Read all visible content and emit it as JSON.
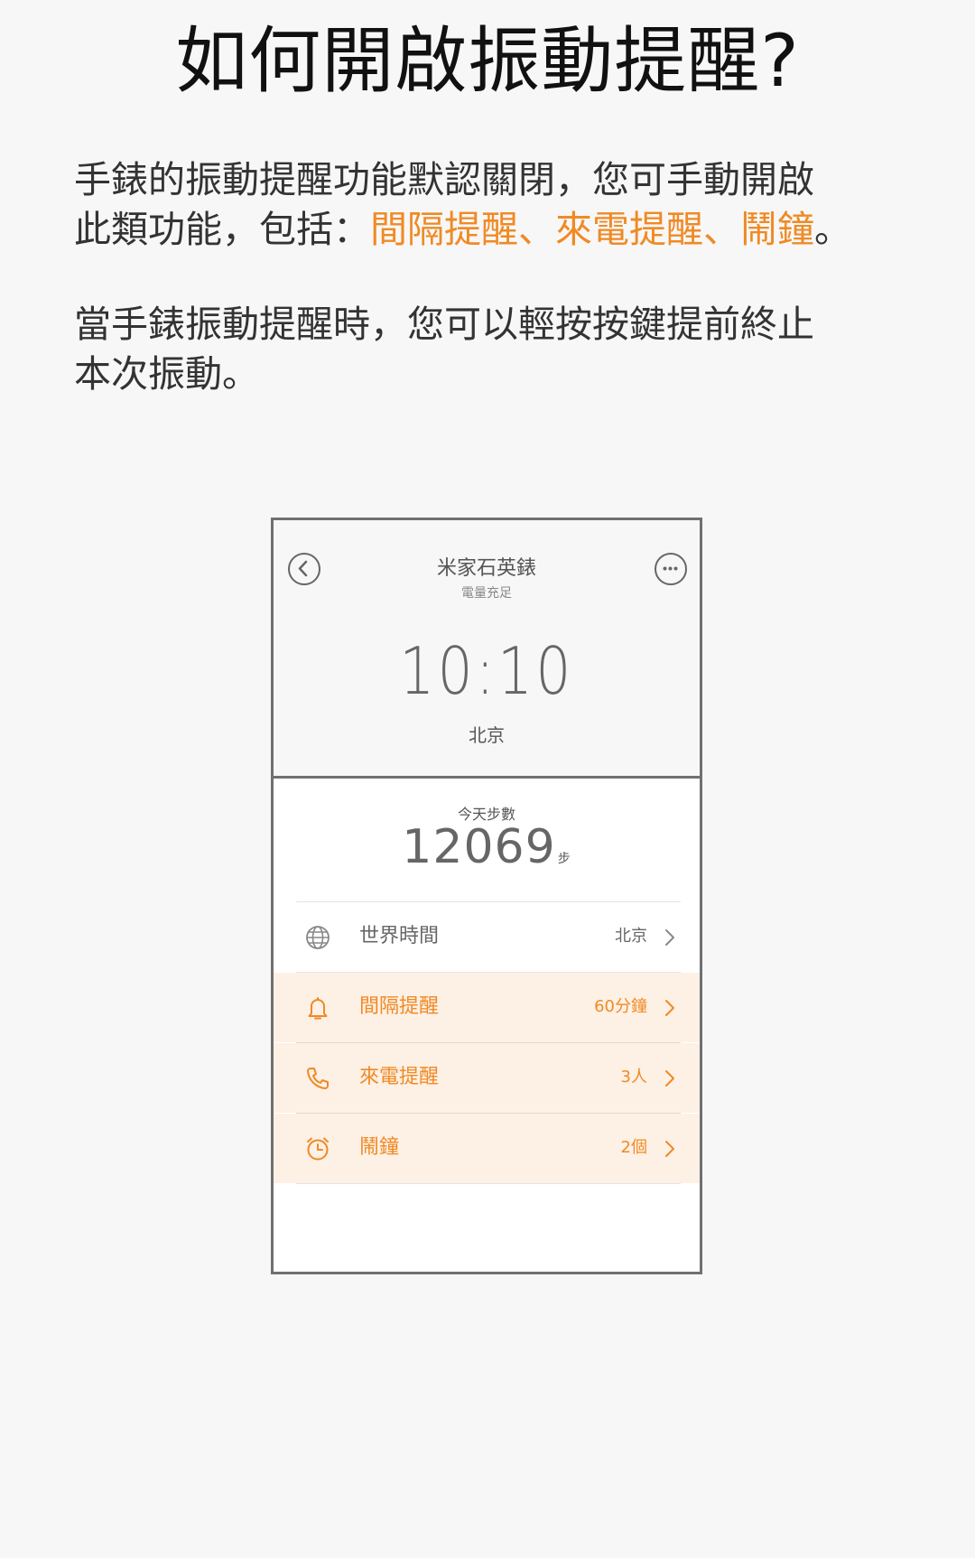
{
  "title": "如何開啟振動提醒?",
  "intro": {
    "line1": "手錶的振動提醒功能默認關閉，您可手動開啟",
    "line2_prefix": "此類功能，包括：",
    "line2_highlight": "間隔提醒、來電提醒、鬧鐘",
    "line2_suffix": "。"
  },
  "note": {
    "line1": "當手錶振動提醒時，您可以輕按按鍵提前終止",
    "line2": "本次振動。"
  },
  "phone": {
    "device_name": "米家石英錶",
    "battery_status": "電量充足",
    "time": "10:10",
    "city": "北京",
    "steps_label": "今天步數",
    "steps": "12069",
    "steps_unit": "步",
    "rows": [
      {
        "label": "世界時間",
        "value": "北京",
        "icon": "globe-icon"
      },
      {
        "label": "間隔提醒",
        "value": "60分鐘",
        "icon": "bell-icon"
      },
      {
        "label": "來電提醒",
        "value": "3人",
        "icon": "phone-icon"
      },
      {
        "label": "鬧鐘",
        "value": "2個",
        "icon": "alarm-clock-icon"
      }
    ]
  },
  "colors": {
    "accent": "#f08a24",
    "row_highlight": "#fdf0e5",
    "frame": "#707070",
    "background": "#f7f7f7"
  }
}
